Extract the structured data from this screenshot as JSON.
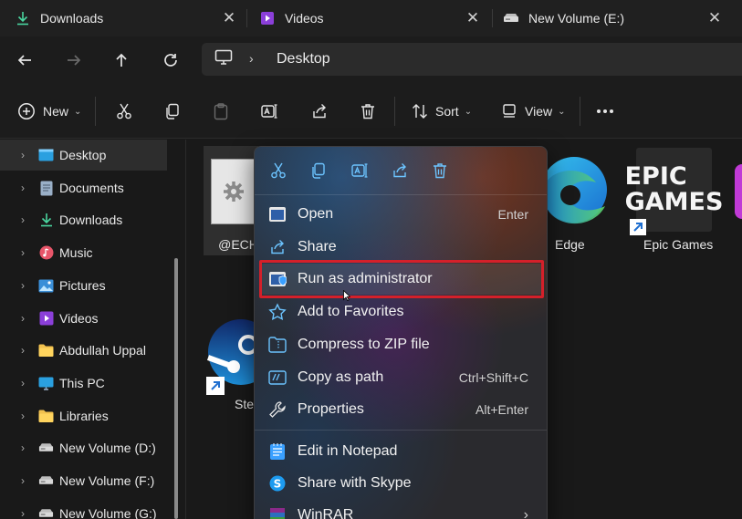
{
  "tabs": [
    {
      "label": "Downloads",
      "icon": "download-icon"
    },
    {
      "label": "Videos",
      "icon": "videos-folder-icon"
    },
    {
      "label": "New Volume (E:)",
      "icon": "drive-icon"
    }
  ],
  "address": {
    "breadcrumb": "Desktop",
    "root_icon": "monitor-icon"
  },
  "toolbar": {
    "new_label": "New",
    "sort_label": "Sort",
    "view_label": "View"
  },
  "sidebar": {
    "items": [
      {
        "label": "Desktop",
        "icon": "desktop-icon"
      },
      {
        "label": "Documents",
        "icon": "documents-icon"
      },
      {
        "label": "Downloads",
        "icon": "download-icon"
      },
      {
        "label": "Music",
        "icon": "music-icon"
      },
      {
        "label": "Pictures",
        "icon": "pictures-icon"
      },
      {
        "label": "Videos",
        "icon": "videos-icon"
      },
      {
        "label": "Abdullah Uppal",
        "icon": "folder-icon"
      },
      {
        "label": "This PC",
        "icon": "this-pc-icon"
      },
      {
        "label": "Libraries",
        "icon": "folder-icon"
      },
      {
        "label": "New Volume (D:)",
        "icon": "drive-icon"
      },
      {
        "label": "New Volume (F:)",
        "icon": "drive-icon"
      },
      {
        "label": "New Volume (G:)",
        "icon": "drive-icon"
      }
    ]
  },
  "files": [
    {
      "label": "@ECH",
      "icon": "settings-file-icon"
    },
    {
      "label": "Edge",
      "icon": "edge-icon"
    },
    {
      "label": "Epic Games",
      "icon": "epic-games-icon",
      "logo_text": "EPIC GAMES"
    },
    {
      "label": "Ste",
      "icon": "steam-icon"
    }
  ],
  "context_menu": {
    "items": [
      {
        "label": "Open",
        "shortcut": "Enter",
        "icon": "open-icon"
      },
      {
        "label": "Share",
        "shortcut": "",
        "icon": "share-icon"
      },
      {
        "label": "Run as administrator",
        "shortcut": "",
        "icon": "shield-icon"
      },
      {
        "label": "Add to Favorites",
        "shortcut": "",
        "icon": "star-icon"
      },
      {
        "label": "Compress to ZIP file",
        "shortcut": "",
        "icon": "zip-icon"
      },
      {
        "label": "Copy as path",
        "shortcut": "Ctrl+Shift+C",
        "icon": "copy-path-icon"
      },
      {
        "label": "Properties",
        "shortcut": "Alt+Enter",
        "icon": "wrench-icon"
      },
      {
        "label": "Edit in Notepad",
        "shortcut": "",
        "icon": "notepad-icon"
      },
      {
        "label": "Share with Skype",
        "shortcut": "",
        "icon": "skype-icon"
      },
      {
        "label": "WinRAR",
        "shortcut": "",
        "icon": "winrar-icon"
      }
    ]
  },
  "colors": {
    "highlight": "#d4202a",
    "accent": "#4cc2ff"
  }
}
